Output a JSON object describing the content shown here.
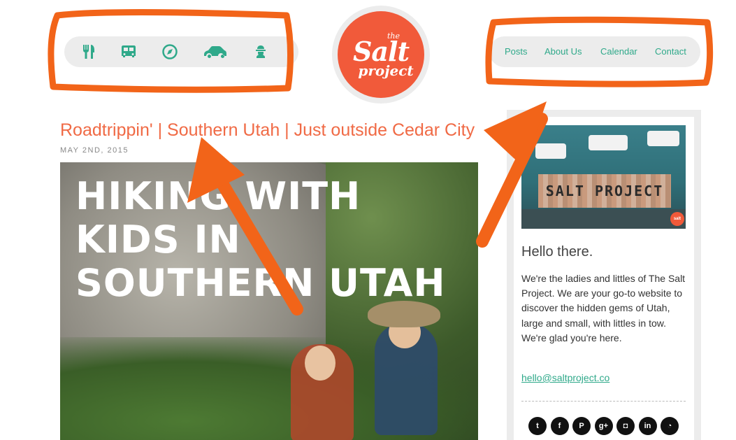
{
  "colors": {
    "accent_orange": "#f06a45",
    "logo_orange": "#f15a3a",
    "teal": "#2fa98a",
    "annotation_orange": "#f26419",
    "nav_gray": "#ececec"
  },
  "header": {
    "icons": [
      "food-icon",
      "bus-icon",
      "compass-icon",
      "car-icon",
      "person-icon"
    ],
    "nav": {
      "posts": "Posts",
      "about": "About Us",
      "calendar": "Calendar",
      "contact": "Contact"
    },
    "logo": {
      "the": "the",
      "salt": "Salt",
      "project": "project"
    }
  },
  "post": {
    "title": "Roadtrippin' | Southern Utah | Just outside Cedar City",
    "date": "MAY 2ND, 2015",
    "hero_lines": [
      "HIKING WITH",
      "KIDS IN",
      "SOUTHERN UTAH"
    ]
  },
  "sidebar": {
    "photo_sign": "SALT PROJECT",
    "photo_logo": "salt",
    "heading": "Hello there.",
    "text": "We're the ladies and littles of The Salt Project. We are your go-to website to discover the hidden gems of Utah, large and small, with littles in tow.  We're glad you're here.",
    "email": "hello@saltproject.co",
    "social": [
      {
        "name": "twitter-icon",
        "glyph": "t"
      },
      {
        "name": "facebook-icon",
        "glyph": "f"
      },
      {
        "name": "pinterest-icon",
        "glyph": "P"
      },
      {
        "name": "google-plus-icon",
        "glyph": "g+"
      },
      {
        "name": "instagram-icon",
        "glyph": "◘"
      },
      {
        "name": "linkedin-icon",
        "glyph": "in"
      },
      {
        "name": "rss-icon",
        "glyph": "◔"
      }
    ]
  }
}
